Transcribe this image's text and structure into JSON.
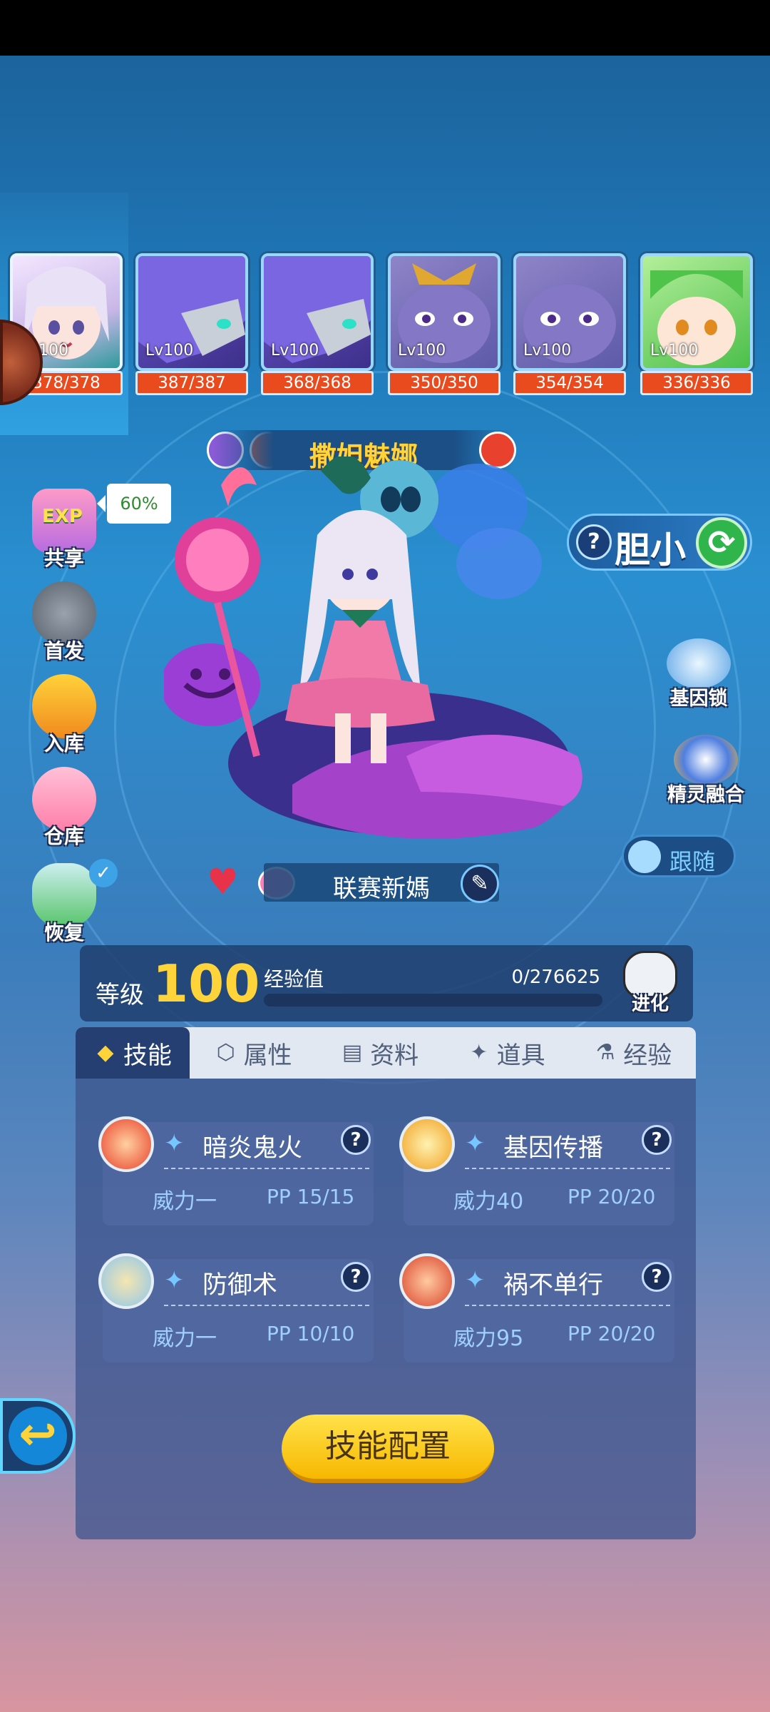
{
  "team": [
    {
      "level": "100",
      "hp": "378/378",
      "active": true
    },
    {
      "level": "Lv100",
      "hp": "387/387"
    },
    {
      "level": "Lv100",
      "hp": "368/368"
    },
    {
      "level": "Lv100",
      "hp": "350/350"
    },
    {
      "level": "Lv100",
      "hp": "354/354"
    },
    {
      "level": "Lv100",
      "hp": "336/336"
    }
  ],
  "pet": {
    "name": "撒妲魅娜",
    "trait": "胆小",
    "nickname": "联赛新媽"
  },
  "left_menu": {
    "share_label": "共享",
    "share_badge": "EXP",
    "share_percent": "60%",
    "first_label": "首发",
    "store_label": "入库",
    "warehouse_label": "仓库",
    "recover_label": "恢复"
  },
  "right_menu": {
    "gene_lock_label": "基因锁",
    "fusion_label": "精灵融合",
    "follow_label": "跟随"
  },
  "level": {
    "label": "等级",
    "value": "100",
    "exp_label": "经验值",
    "exp_value": "0/276625",
    "exp_progress": 0,
    "evolve_label": "进化"
  },
  "tabs": [
    {
      "label": "技能",
      "active": true
    },
    {
      "label": "属性"
    },
    {
      "label": "资料"
    },
    {
      "label": "道具"
    },
    {
      "label": "经验"
    }
  ],
  "skills": [
    {
      "name": "暗炎鬼火",
      "power": "威力一",
      "pp": "PP 15/15",
      "icon_color": "#e8422c"
    },
    {
      "name": "基因传播",
      "power": "威力40",
      "pp": "PP 20/20",
      "icon_color": "#f0a020"
    },
    {
      "name": "防御术",
      "power": "威力一",
      "pp": "PP 10/10",
      "icon_color": "#8fc6ea"
    },
    {
      "name": "祸不单行",
      "power": "威力95",
      "pp": "PP 20/20",
      "icon_color": "#d9442c"
    }
  ],
  "skill_config_label": "技能配置",
  "colors": {
    "accent_yellow": "#ffd43b",
    "hp_red": "#e94a1e",
    "panel": "#253f73"
  }
}
